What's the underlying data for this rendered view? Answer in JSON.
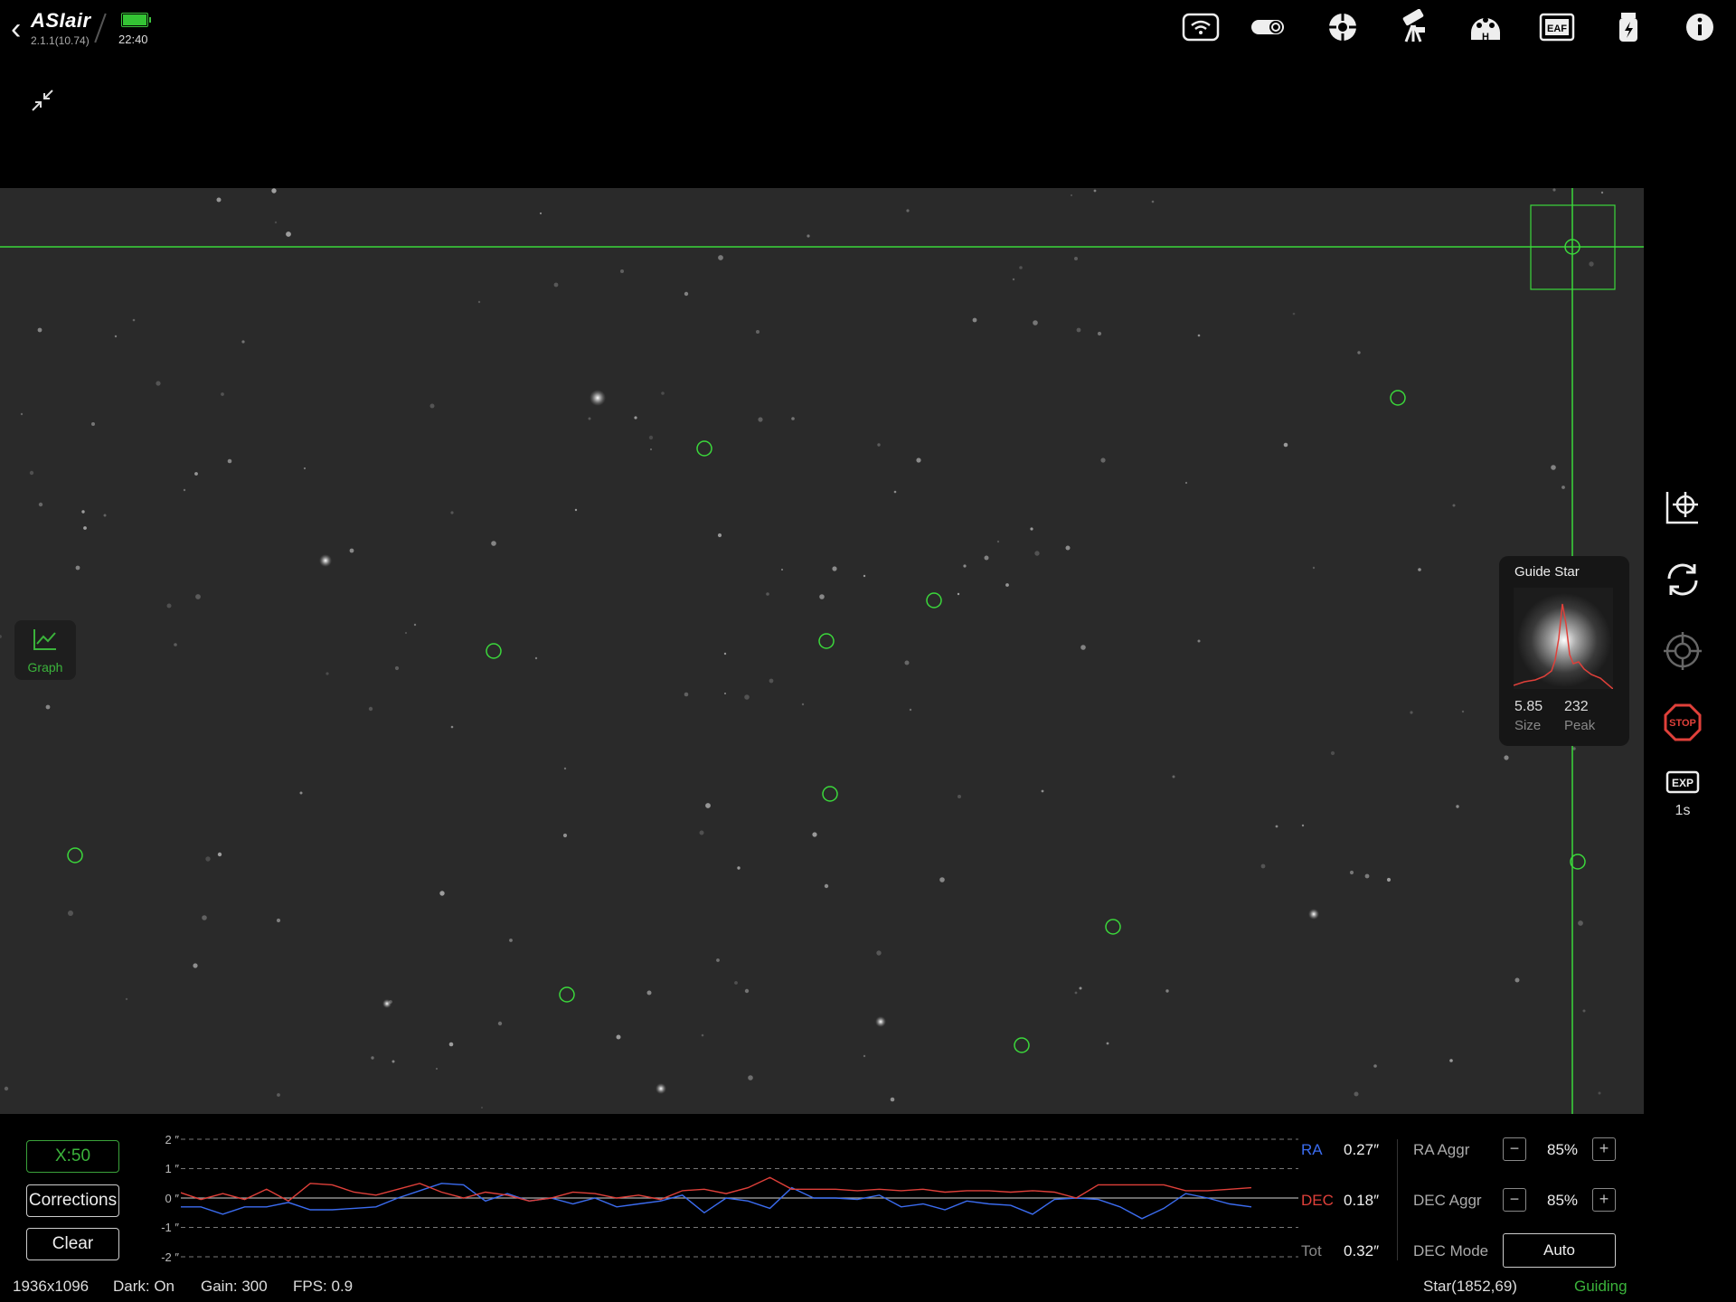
{
  "app": {
    "name": "ASIair",
    "version": "2.1.1(10.74)",
    "time": "22:40",
    "battery_level": 1.0
  },
  "toolbar_icons": [
    "wifi-icon",
    "camera-icon",
    "guide-camera-icon",
    "mount-icon",
    "filter-wheel-icon",
    "eaf-icon",
    "power-icon",
    "info-icon"
  ],
  "colors": {
    "accent": "#3bb33b",
    "ra": "#3b6cf0",
    "dec": "#e0403a",
    "stop": "#e0403a",
    "background": "#000000"
  },
  "right_tools": {
    "exposure_label": "1s"
  },
  "guide_star": {
    "title": "Guide Star",
    "size_value": "5.85",
    "size_label": "Size",
    "peak_value": "232",
    "peak_label": "Peak"
  },
  "graph_toggle": {
    "label": "Graph"
  },
  "controls": {
    "scale_label": "X:50",
    "corrections_label": "Corrections",
    "clear_label": "Clear"
  },
  "chart_data": {
    "type": "line",
    "y_unit": "″",
    "y_ticks": [
      "2 ″",
      "1 ″",
      "0 ″",
      "-1 ″",
      "-2 ″"
    ],
    "ylim": [
      -2,
      2
    ],
    "x_count": 50,
    "series": [
      {
        "name": "RA",
        "values": [
          -0.3,
          -0.3,
          -0.55,
          -0.3,
          -0.3,
          -0.15,
          -0.4,
          -0.4,
          -0.35,
          -0.3,
          0,
          0.25,
          0.5,
          0.45,
          -0.1,
          0.15,
          -0.1,
          0,
          -0.2,
          0,
          -0.3,
          -0.2,
          -0.1,
          0.1,
          -0.5,
          0,
          -0.1,
          -0.35,
          0.35,
          0,
          0,
          -0.05,
          0.1,
          -0.3,
          -0.2,
          -0.4,
          -0.1,
          -0.2,
          -0.25,
          -0.55,
          -0.05,
          0,
          -0.05,
          -0.3,
          -0.7,
          -0.35,
          0.15,
          0,
          -0.2,
          -0.3
        ]
      },
      {
        "name": "DEC",
        "values": [
          0.2,
          -0.05,
          0.15,
          -0.05,
          0.3,
          -0.1,
          0.5,
          0.45,
          0.2,
          0.1,
          0.3,
          0.5,
          0.2,
          0,
          0.2,
          0.1,
          -0.1,
          0,
          0.2,
          0.15,
          0,
          0.1,
          -0.05,
          0.25,
          0.3,
          0.15,
          0.35,
          0.7,
          0.3,
          0.3,
          0.3,
          0.25,
          0.3,
          0.25,
          0.3,
          0.2,
          0.25,
          0.25,
          0.2,
          0.25,
          0.2,
          0,
          0.45,
          0.45,
          0.45,
          0.45,
          0.25,
          0.25,
          0.3,
          0.35
        ]
      }
    ]
  },
  "legend": {
    "ra_label": "RA",
    "ra_value": "0.27″",
    "dec_label": "DEC",
    "dec_value": "0.18″",
    "tot_label": "Tot",
    "tot_value": "0.32″"
  },
  "aggressiveness": {
    "ra_label": "RA Aggr",
    "ra_value": "85%",
    "dec_label": "DEC Aggr",
    "dec_value": "85%",
    "dec_mode_label": "DEC Mode",
    "dec_mode_value": "Auto"
  },
  "status": {
    "resolution": "1936x1096",
    "dark": "Dark: On",
    "gain": "Gain: 300",
    "fps": "FPS: 0.9",
    "star": "Star(1852,69)",
    "state": "Guiding"
  }
}
